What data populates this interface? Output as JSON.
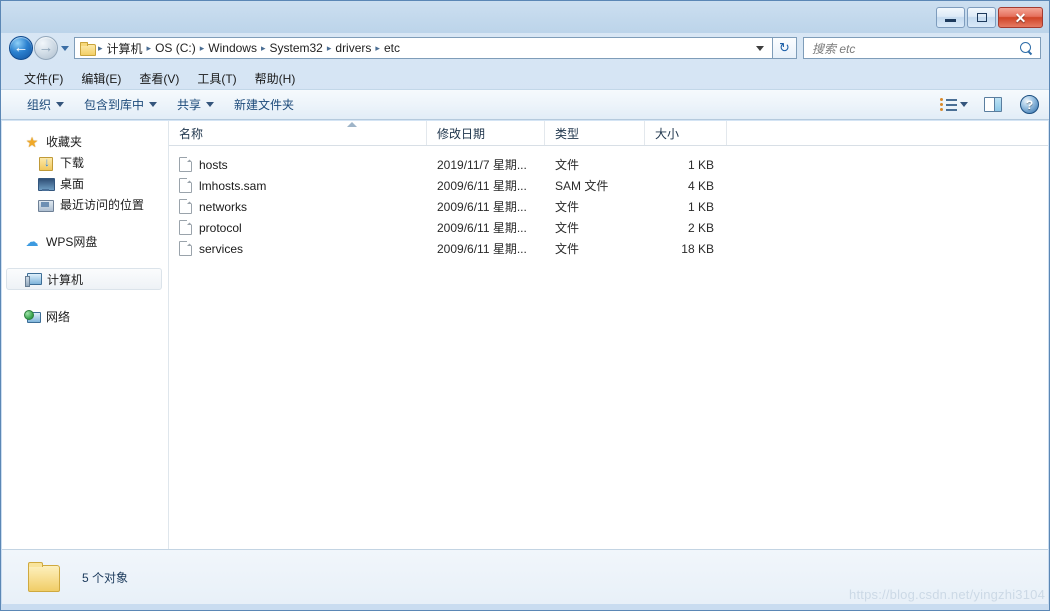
{
  "window": {
    "buttons": [
      {
        "name": "minimize",
        "label": ""
      },
      {
        "name": "maximize",
        "label": ""
      },
      {
        "name": "close",
        "label": "✕"
      }
    ]
  },
  "navigation": {
    "back_label": "←",
    "forward_label": "→",
    "recent_pages_label": "",
    "refresh_label": "↻",
    "breadcrumb": [
      "计算机",
      "OS (C:)",
      "Windows",
      "System32",
      "drivers",
      "etc"
    ],
    "separator": "▸"
  },
  "search": {
    "placeholder": "搜索 etc",
    "value": ""
  },
  "menubar": {
    "items": [
      {
        "label": "文件(F)"
      },
      {
        "label": "编辑(E)"
      },
      {
        "label": "查看(V)"
      },
      {
        "label": "工具(T)"
      },
      {
        "label": "帮助(H)"
      }
    ]
  },
  "toolbar": {
    "organize_label": "组织",
    "include_library_label": "包含到库中",
    "share_label": "共享",
    "new_folder_label": "新建文件夹",
    "help_label": "?"
  },
  "sidebar": {
    "sections": [
      {
        "label": "收藏夹",
        "icon": "star-icon",
        "level": "root"
      },
      {
        "label": "下载",
        "icon": "downloads-icon",
        "level": "child"
      },
      {
        "label": "桌面",
        "icon": "desktop-icon",
        "level": "child"
      },
      {
        "label": "最近访问的位置",
        "icon": "recent-places-icon",
        "level": "child"
      },
      {
        "label": "WPS网盘",
        "icon": "cloud-icon",
        "level": "root"
      },
      {
        "label": "计算机",
        "icon": "computer-icon",
        "level": "root",
        "selected": true
      },
      {
        "label": "网络",
        "icon": "network-icon",
        "level": "root"
      }
    ]
  },
  "filelist": {
    "columns": [
      {
        "label": "名称",
        "sorted": "asc"
      },
      {
        "label": "修改日期"
      },
      {
        "label": "类型"
      },
      {
        "label": "大小"
      }
    ],
    "rows": [
      {
        "name": "hosts",
        "date": "2019/11/7 星期...",
        "type": "文件",
        "size": "1 KB"
      },
      {
        "name": "lmhosts.sam",
        "date": "2009/6/11 星期...",
        "type": "SAM 文件",
        "size": "4 KB"
      },
      {
        "name": "networks",
        "date": "2009/6/11 星期...",
        "type": "文件",
        "size": "1 KB"
      },
      {
        "name": "protocol",
        "date": "2009/6/11 星期...",
        "type": "文件",
        "size": "2 KB"
      },
      {
        "name": "services",
        "date": "2009/6/11 星期...",
        "type": "文件",
        "size": "18 KB"
      }
    ]
  },
  "statusbar": {
    "text": "5 个对象"
  },
  "watermark": {
    "text": "https://blog.csdn.net/yingzhi3104"
  },
  "colors": {
    "frame": "#5b87b5",
    "glass": "#cfe0f2",
    "accent": "#2d6ca8",
    "folder": "#f3cf67"
  }
}
